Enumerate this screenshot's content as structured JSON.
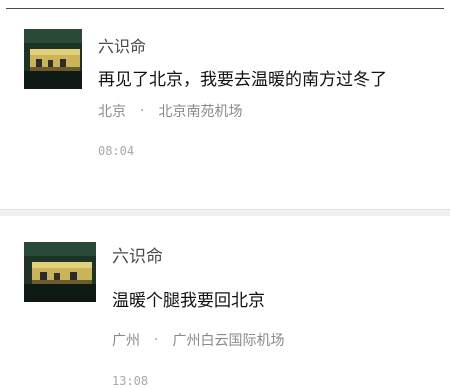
{
  "posts": [
    {
      "author": "六识命",
      "content": "再见了北京，我要去温暖的南方过冬了",
      "location_city": "北京",
      "location_separator": "·",
      "location_place": "北京南苑机场",
      "time": "08:04"
    },
    {
      "author": "六识命",
      "content": "温暖个腿我要回北京",
      "location_city": "广州",
      "location_separator": "·",
      "location_place": "广州白云国际机场",
      "time": "13:08"
    }
  ],
  "colors": {
    "background": "#ffffff",
    "name": "#4a4a4a",
    "content": "#111111",
    "meta": "#8a8a8a",
    "divider_band": "#f0f0f0"
  },
  "icons": {
    "avatar": "avatar-image"
  }
}
